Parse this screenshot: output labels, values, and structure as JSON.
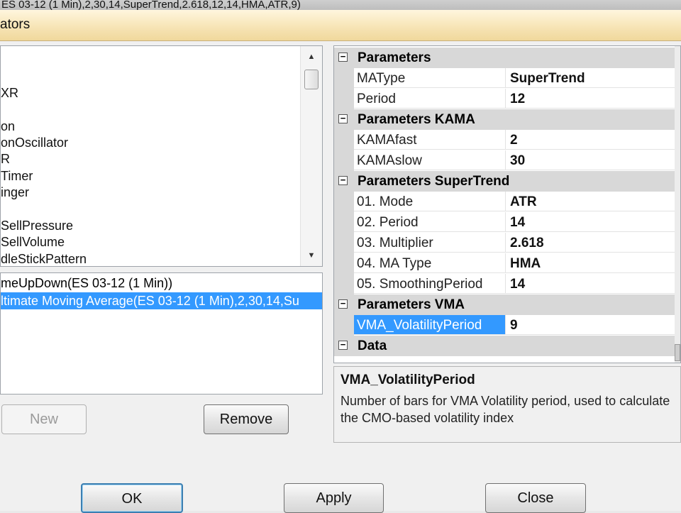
{
  "chart_title_strip": "ES 03-12 (1 Min),2,30,14,SuperTrend,2.618,12,14,HMA,ATR,9)",
  "window_title": "ators",
  "indicator_list": [
    "",
    "",
    "XR",
    "",
    "on",
    "onOscillator",
    "R",
    "Timer",
    "inger",
    "",
    "SellPressure",
    "SellVolume",
    "dleStickPattern"
  ],
  "applied_list": [
    {
      "label": "meUpDown(ES 03-12 (1 Min))",
      "selected": false
    },
    {
      "label": "ltimate Moving Average(ES 03-12 (1 Min),2,30,14,Su",
      "selected": true
    }
  ],
  "buttons": {
    "new": "New",
    "remove": "Remove",
    "ok": "OK",
    "apply": "Apply",
    "close": "Close"
  },
  "property_grid": {
    "categories": [
      {
        "label": "Parameters",
        "toggle": "−",
        "properties": [
          {
            "name": "MAType",
            "value": "SuperTrend"
          },
          {
            "name": "Period",
            "value": "12"
          }
        ]
      },
      {
        "label": "Parameters KAMA",
        "toggle": "−",
        "properties": [
          {
            "name": "KAMAfast",
            "value": "2"
          },
          {
            "name": "KAMAslow",
            "value": "30"
          }
        ]
      },
      {
        "label": "Parameters SuperTrend",
        "toggle": "−",
        "properties": [
          {
            "name": "01. Mode",
            "value": "ATR"
          },
          {
            "name": "02. Period",
            "value": "14"
          },
          {
            "name": "03. Multiplier",
            "value": "2.618"
          },
          {
            "name": "04. MA Type",
            "value": "HMA"
          },
          {
            "name": "05. SmoothingPeriod",
            "value": "14"
          }
        ]
      },
      {
        "label": "Parameters VMA",
        "toggle": "−",
        "properties": [
          {
            "name": "VMA_VolatilityPeriod",
            "value": "9",
            "selected": true
          }
        ]
      },
      {
        "label": "Data",
        "toggle": "−",
        "properties": []
      }
    ]
  },
  "help": {
    "title": "VMA_VolatilityPeriod",
    "description": "Number of bars for VMA Volatility period, used to calculate the CMO-based volatility index"
  },
  "scroll_glyphs": {
    "up": "▲",
    "down": "▼"
  }
}
